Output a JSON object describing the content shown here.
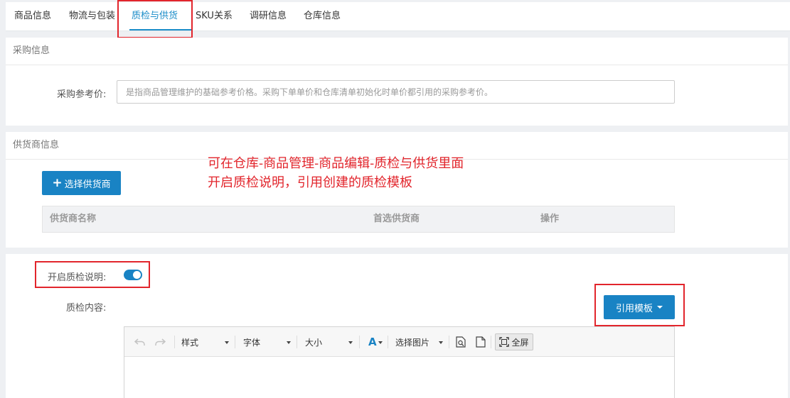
{
  "tabs": [
    {
      "label": "商品信息"
    },
    {
      "label": "物流与包装"
    },
    {
      "label": "质检与供货"
    },
    {
      "label": "SKU关系"
    },
    {
      "label": "调研信息"
    },
    {
      "label": "仓库信息"
    }
  ],
  "active_tab": "质检与供货",
  "purchase": {
    "title": "采购信息",
    "ref_price_label": "采购参考价:",
    "ref_price_placeholder": "是指商品管理维护的基础参考价格。采购下单单价和仓库清单初始化时单价都引用的采购参考价。",
    "ref_price_value": ""
  },
  "supplier": {
    "title": "供货商信息",
    "select_button": "选择供货商",
    "columns": [
      "供货商名称",
      "首选供货商",
      "操作"
    ]
  },
  "annotation": {
    "line1": "可在仓库-商品管理-商品编辑-质检与供货里面",
    "line2": "开启质检说明，引用创建的质检模板"
  },
  "qc": {
    "toggle_label": "开启质检说明:",
    "toggle_on": true,
    "content_label": "质检内容:",
    "template_button": "引用模板"
  },
  "editor_toolbar": {
    "style": "样式",
    "font": "字体",
    "size": "大小",
    "font_color": "A",
    "image": "选择图片",
    "fullscreen": "全屏"
  },
  "colors": {
    "accent": "#1983c4",
    "annotation_red": "#e2252c"
  }
}
